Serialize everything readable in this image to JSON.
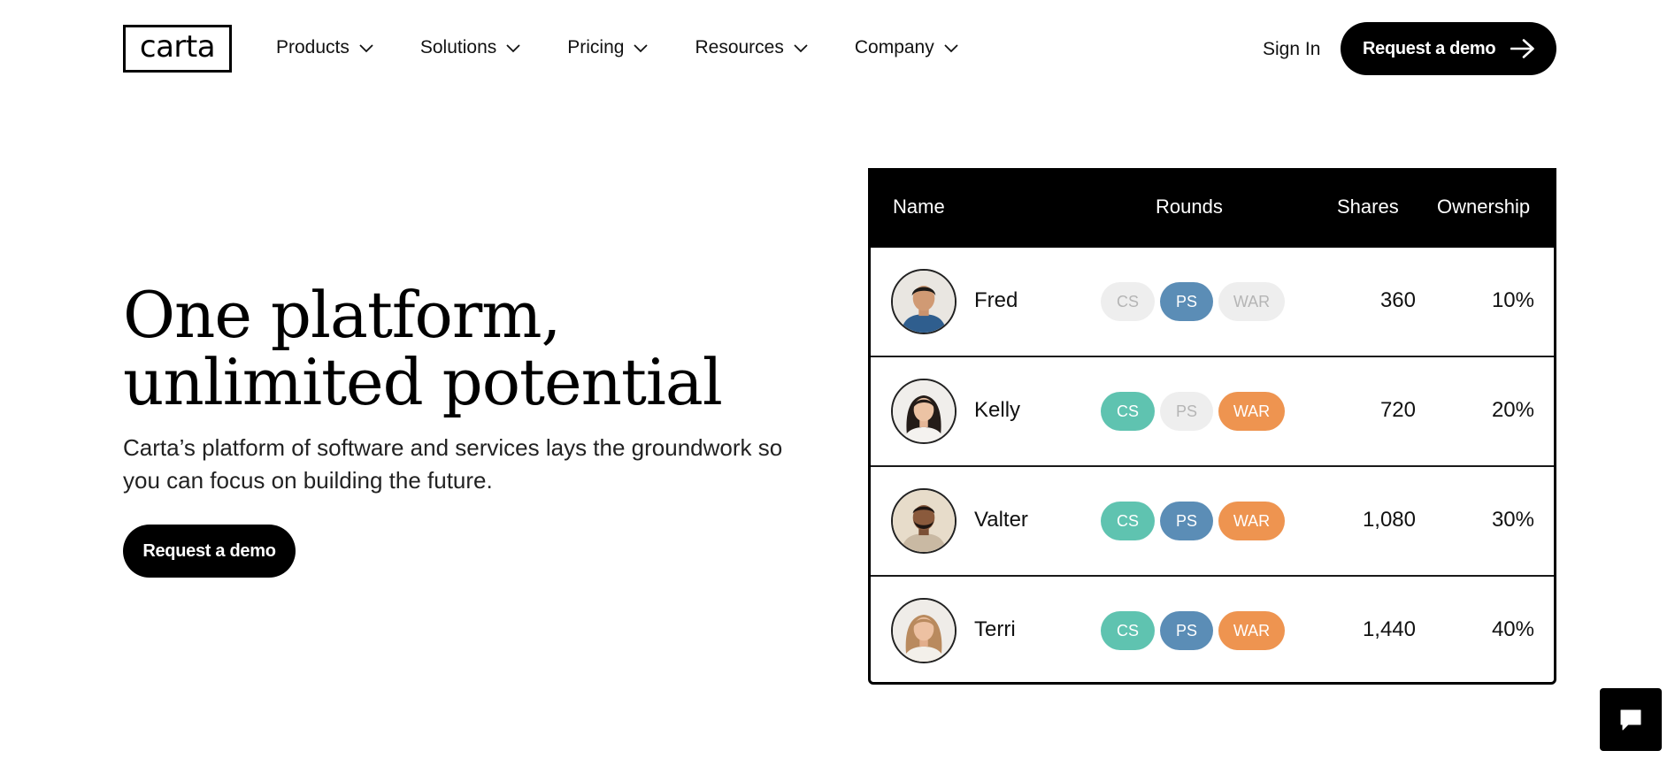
{
  "brand": {
    "logo_text": "carta"
  },
  "nav": {
    "items": [
      {
        "label": "Products"
      },
      {
        "label": "Solutions"
      },
      {
        "label": "Pricing"
      },
      {
        "label": "Resources"
      },
      {
        "label": "Company"
      }
    ],
    "sign_in": "Sign In",
    "cta": "Request a demo"
  },
  "hero": {
    "title": "One platform, unlimited potential",
    "subtitle": "Carta’s platform of software and services lays the groundwork so you can focus on building the future.",
    "cta": "Request a demo"
  },
  "cap_table": {
    "columns": [
      "Name",
      "Rounds",
      "Shares",
      "Ownership"
    ],
    "round_labels": [
      "CS",
      "PS",
      "WAR"
    ],
    "rows": [
      {
        "name": "Fred",
        "rounds": {
          "CS": false,
          "PS": true,
          "WAR": false
        },
        "shares": "360",
        "ownership": "10%"
      },
      {
        "name": "Kelly",
        "rounds": {
          "CS": true,
          "PS": false,
          "WAR": true
        },
        "shares": "720",
        "ownership": "20%"
      },
      {
        "name": "Valter",
        "rounds": {
          "CS": true,
          "PS": true,
          "WAR": true
        },
        "shares": "1,080",
        "ownership": "30%"
      },
      {
        "name": "Terri",
        "rounds": {
          "CS": true,
          "PS": true,
          "WAR": true
        },
        "shares": "1,440",
        "ownership": "40%"
      }
    ],
    "colors": {
      "CS": "#5fc3b0",
      "PS": "#5b8db6",
      "WAR": "#ee9450",
      "inactive": "#eeeeee"
    }
  },
  "icons": {
    "chevron": "chevron-down-icon",
    "arrow": "arrow-right-icon",
    "chat": "chat-bubble-icon"
  }
}
